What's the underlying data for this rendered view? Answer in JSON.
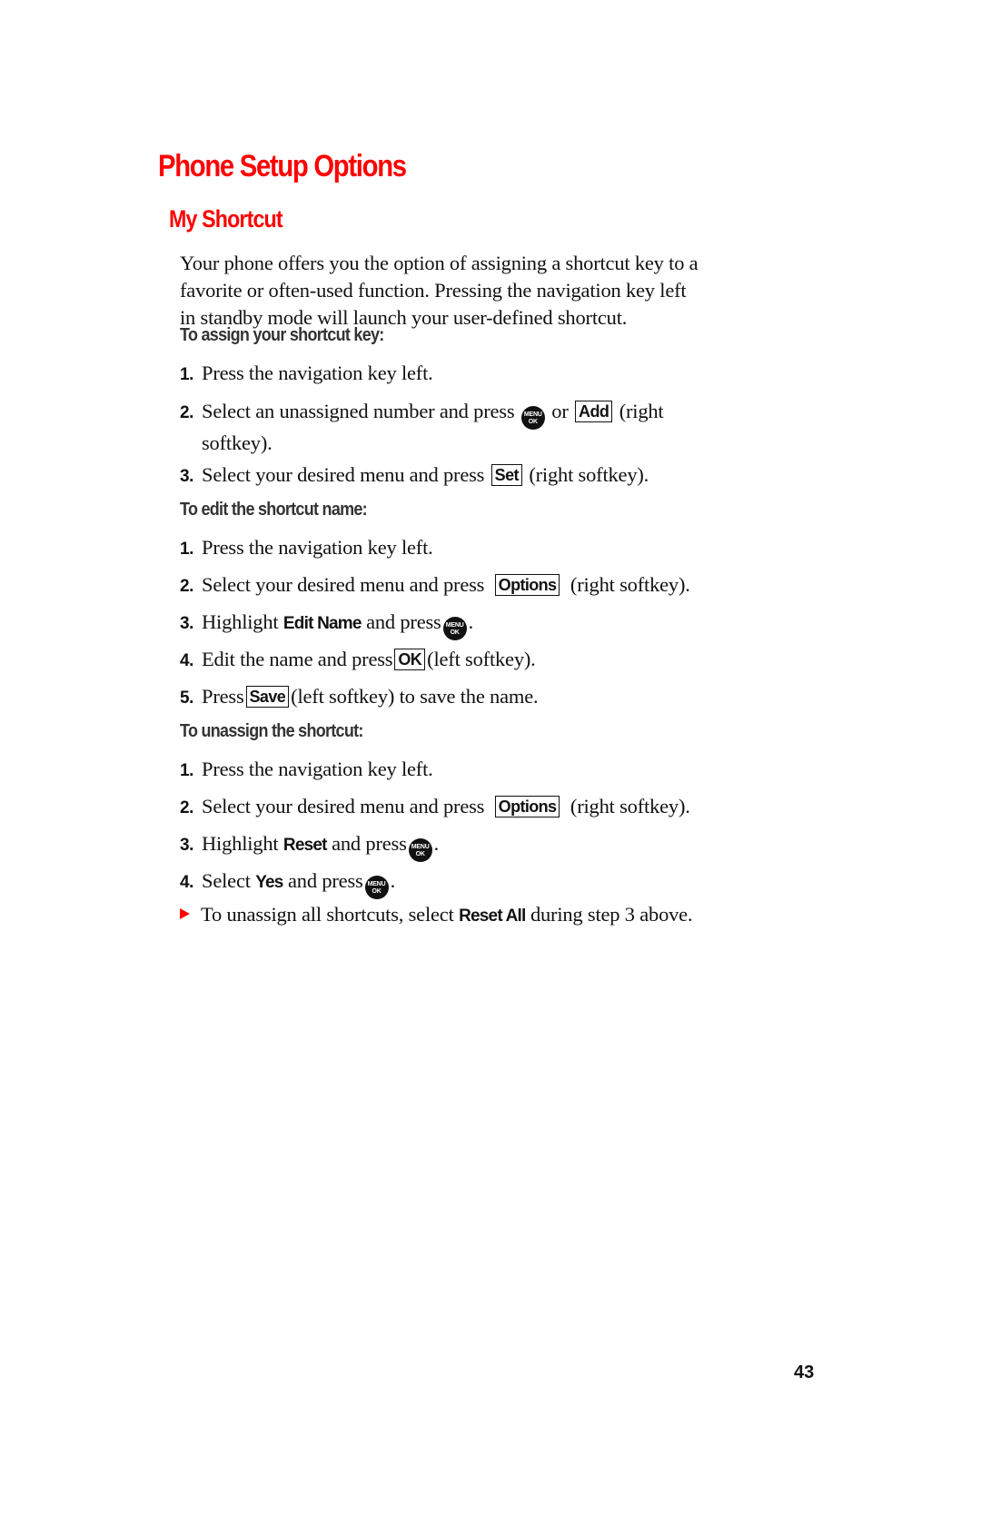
{
  "page": {
    "title": "Phone Setup Options",
    "subtitle": "My Shortcut",
    "intro_lines": [
      "Your phone offers you the option of assigning a shortcut key to a",
      "favorite or often-used function. Pressing the navigation key left",
      "in standby mode will launch your user-defined shortcut."
    ],
    "page_number": "43",
    "accent_color": "#ff0000"
  },
  "keys": {
    "menu_ok_top": "MENU",
    "menu_ok_bottom": "OK",
    "add": "Add",
    "set": "Set",
    "options": "Options",
    "ok": "OK",
    "save": "Save"
  },
  "assign": {
    "heading": "To assign your shortcut key:",
    "steps": [
      {
        "num": "1.",
        "text": "Press the navigation key left."
      },
      {
        "num": "2.",
        "pre": "Select an unassigned number and press",
        "mid": "or",
        "post": "(right",
        "cont": "softkey)."
      },
      {
        "num": "3.",
        "pre": "Select your desired menu and press",
        "post": "(right softkey)."
      }
    ]
  },
  "edit": {
    "heading": "To edit the shortcut name:",
    "steps": [
      {
        "num": "1.",
        "text": "Press the navigation key left."
      },
      {
        "num": "2.",
        "pre": "Select your desired menu and press",
        "post": "(right softkey)."
      },
      {
        "num": "3.",
        "pre": "Highlight",
        "term": "Edit Name",
        "post": "and press",
        "end": "."
      },
      {
        "num": "4.",
        "pre": "Edit the name and press",
        "post": "(left softkey)."
      },
      {
        "num": "5.",
        "pre": "Press",
        "post": "(left softkey) to save the name."
      }
    ]
  },
  "unassign": {
    "heading": "To unassign the shortcut:",
    "steps": [
      {
        "num": "1.",
        "text": "Press the navigation key left."
      },
      {
        "num": "2.",
        "pre": "Select your desired menu and press",
        "post": "(right softkey)."
      },
      {
        "num": "3.",
        "pre": "Highlight",
        "term": "Reset",
        "post": "and press",
        "end": "."
      },
      {
        "num": "4.",
        "pre": "Select",
        "term": "Yes",
        "post": "and press",
        "end": "."
      }
    ],
    "tip": {
      "pre": "To unassign all shortcuts, select",
      "term": "Reset All",
      "post": "during step 3 above."
    }
  }
}
